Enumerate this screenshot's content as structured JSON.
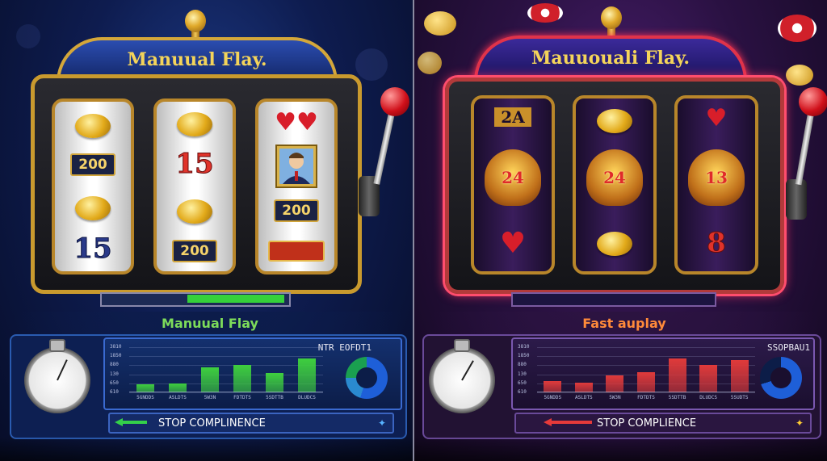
{
  "left_machine": {
    "marquee_title": "Manuual Flay.",
    "reels": [
      {
        "symbols": [
          "coin",
          "200",
          "coin",
          "15"
        ]
      },
      {
        "symbols": [
          "coin",
          "15",
          "coin",
          "200"
        ]
      },
      {
        "symbols": [
          "hearts",
          "portrait",
          "200",
          "banner"
        ]
      }
    ],
    "reel_numbers": {
      "r1_mid": "200",
      "r1_bottom": "15",
      "r2_mid": "15",
      "r2_bottom": "200",
      "r3_mid": "200"
    },
    "mode_label": "Manuual Flay",
    "chart": {
      "title": "NTR EOFDT1",
      "y_ticks": [
        "3810",
        "1850",
        "880",
        "130",
        "650",
        "610"
      ],
      "x_ticks": [
        "5GNDDS",
        "ASLDTS",
        "5W3N",
        "FDTDTS",
        "5SDTTB",
        "DLUDCS"
      ],
      "accent_color": "#3ecf3e"
    },
    "stop_bar_label": "STOP COMPLINENCE"
  },
  "right_machine": {
    "marquee_title": "Mauuouali Flay.",
    "reel_numbers": {
      "r1_top": "2A",
      "r1_mid": "24",
      "r2_mid": "24",
      "r3_mid": "13",
      "r3_bottom": "8"
    },
    "mode_label": "Fast auplay",
    "chart": {
      "title": "SSOPBAU1",
      "y_ticks": [
        "3810",
        "1850",
        "880",
        "130",
        "650",
        "610"
      ],
      "x_ticks": [
        "5GNDDS",
        "ASLDTS",
        "5W3N",
        "FDTDTS",
        "5SDTTB",
        "DLUDCS",
        "5SUDTS"
      ],
      "accent_color": "#e03a3a"
    },
    "stop_bar_label": "STOP COMPLIENCE"
  },
  "chart_data": [
    {
      "type": "bar",
      "title": "NTR EOFDT1",
      "categories": [
        "5GNDDS",
        "ASLDTS",
        "5W3N",
        "FDTDTS",
        "5SDTTB",
        "DLUDCS"
      ],
      "values": [
        18,
        20,
        55,
        60,
        42,
        75
      ],
      "ylim": [
        0,
        100
      ]
    },
    {
      "type": "bar",
      "title": "SSOPBAU1",
      "categories": [
        "5GNDDS",
        "ASLDTS",
        "5W3N",
        "FDTDTS",
        "5SDTTB",
        "DLUDCS",
        "5SUDTS"
      ],
      "values": [
        25,
        22,
        38,
        45,
        75,
        60,
        72
      ],
      "ylim": [
        0,
        100
      ]
    }
  ]
}
